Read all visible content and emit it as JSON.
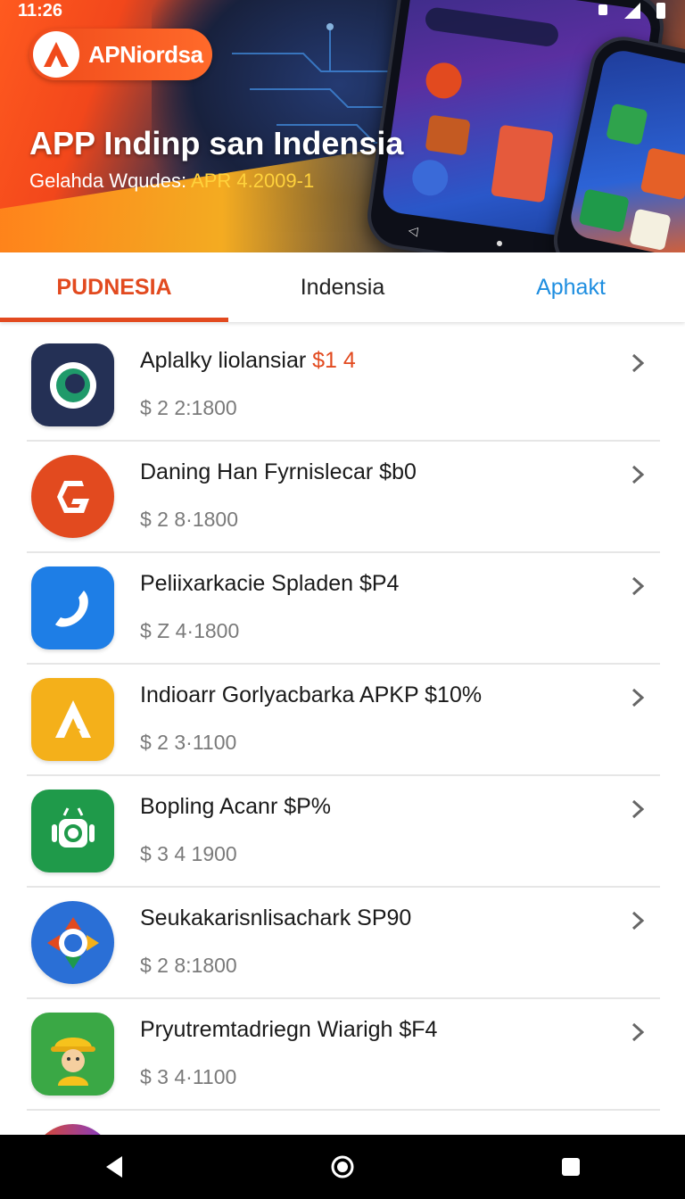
{
  "status_bar": {
    "time": "11:26"
  },
  "hero": {
    "logo_text": "APNiordsa",
    "title": "APP Indinp san Indensia",
    "subtitle_prefix": "Gelahda Wqudes: ",
    "subtitle_date": "APR 4.2009-1"
  },
  "tabs": [
    {
      "label": "PUDNESIA",
      "active": true
    },
    {
      "label": "Indensia",
      "active": false
    },
    {
      "label": "Aphakt",
      "active": false
    }
  ],
  "apps": [
    {
      "name": "Aplalky liolansiar",
      "name_accent": "$1 4",
      "price": "$ 2 2:1800",
      "icon": "ring-icon",
      "color": "#243055"
    },
    {
      "name": "Daning Han Fyrnislecar $b0",
      "name_accent": "",
      "price": "$ 2 8·1800",
      "icon": "g-logo-icon",
      "color": "#e24a1f"
    },
    {
      "name": "Peliixarkacie Spladen $P4",
      "name_accent": "",
      "price": "$ Z 4·1800",
      "icon": "phone-icon",
      "color": "#1e7ee6"
    },
    {
      "name": "Indioarr Gorlyacbarka APKP $10%",
      "name_accent": "",
      "price": "$ 2 3·1100",
      "icon": "letter-a-icon",
      "color": "#f4b01a"
    },
    {
      "name": "Bopling Acanr $P%",
      "name_accent": "",
      "price": "$ 3 4 1900",
      "icon": "android-icon",
      "color": "#1f9a4a"
    },
    {
      "name": "Seukakarisnlisachark SP90",
      "name_accent": "",
      "price": "$ 2 8:1800",
      "icon": "compass-icon",
      "color": "#2a6fd6"
    },
    {
      "name": "Pryutremtadriegn Wiarigh $F4",
      "name_accent": "",
      "price": "$ 3 4·1100",
      "icon": "worker-icon",
      "color": "#3aa845"
    }
  ],
  "nav": {
    "back": "back-icon",
    "home": "home-icon",
    "recents": "recents-icon"
  }
}
